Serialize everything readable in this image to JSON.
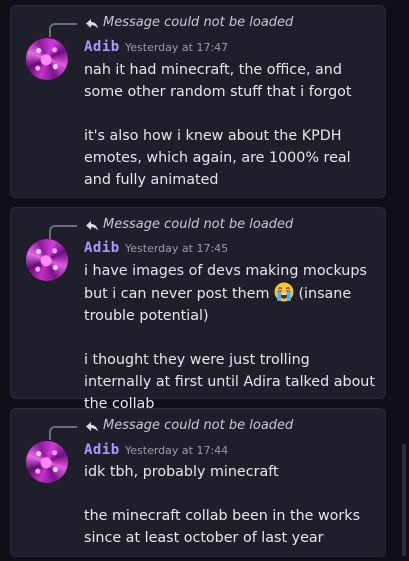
{
  "messages": [
    {
      "reply_text": "Message could not be loaded",
      "username": "Adib",
      "timestamp": "Yesterday at 17:47",
      "paragraphs": [
        "nah it had minecraft, the office, and some other random stuff that i forgot",
        "it's also how i knew about the KPDH emotes, which again, are 1000% real and fully animated"
      ]
    },
    {
      "reply_text": "Message could not be loaded",
      "username": "Adib",
      "timestamp": "Yesterday at 17:45",
      "paragraphs": [
        "i have images of devs making mockups but i can never post them",
        "(insane trouble potential)",
        "i thought they were just trolling internally at first until Adira talked about the collab"
      ],
      "emoji": "loudly-crying-face-icon"
    },
    {
      "reply_text": "Message could not be loaded",
      "username": "Adib",
      "timestamp": "Yesterday at 17:44",
      "paragraphs": [
        "idk tbh, probably minecraft",
        "the minecraft collab been in the works since at least october of last year"
      ]
    }
  ],
  "colors": {
    "background": "#0f1017",
    "card": "#1e1f2a",
    "username": "#a99aff",
    "text": "#e6e7ee",
    "muted": "#9a9cab"
  }
}
